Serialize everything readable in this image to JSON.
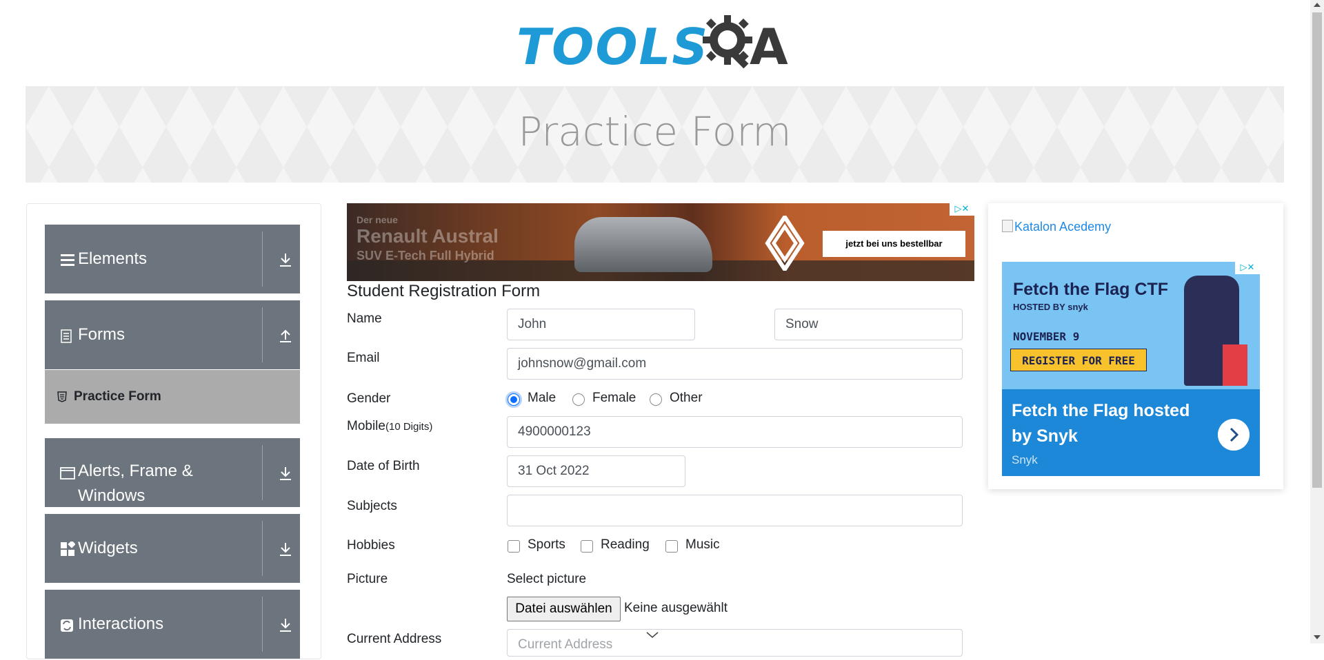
{
  "logo": {
    "part1": "TOOLS",
    "part2": "A"
  },
  "banner": {
    "title": "Practice Form"
  },
  "sidebar": {
    "groups": [
      {
        "label": "Elements",
        "icon": "list-icon",
        "arrow": "download-arrow-icon"
      },
      {
        "label": "Forms",
        "icon": "document-icon",
        "arrow": "upload-arrow-icon"
      },
      {
        "label": "Alerts, Frame & Windows",
        "label_line1": "Alerts, Frame &",
        "label_line2": "Windows",
        "icon": "window-icon",
        "arrow": "download-arrow-icon"
      },
      {
        "label": "Widgets",
        "icon": "widgets-icon",
        "arrow": "download-arrow-icon"
      },
      {
        "label": "Interactions",
        "icon": "interactions-icon",
        "arrow": "download-arrow-icon"
      }
    ],
    "active_item": {
      "label": "Practice Form",
      "icon": "html5-icon"
    }
  },
  "ad_top": {
    "text1": "Der neue",
    "text2": "Renault Austral",
    "text3": "SUV E-Tech Full Hybrid",
    "cta": "jetzt bei uns bestellbar"
  },
  "form": {
    "title": "Student Registration Form",
    "name_label": "Name",
    "first_name": "John",
    "last_name": "Snow",
    "email_label": "Email",
    "email": "johnsnow@gmail.com",
    "gender_label": "Gender",
    "gender_options": [
      "Male",
      "Female",
      "Other"
    ],
    "gender_selected": "Male",
    "mobile_label": "Mobile",
    "mobile_hint": "(10 Digits)",
    "mobile": "4900000123",
    "dob_label": "Date of Birth",
    "dob": "31 Oct 2022",
    "subjects_label": "Subjects",
    "subjects": "",
    "hobbies_label": "Hobbies",
    "hobbies": [
      "Sports",
      "Reading",
      "Music"
    ],
    "picture_label": "Picture",
    "select_picture": "Select picture",
    "file_button": "Datei auswählen",
    "file_status": "Keine ausgewählt",
    "address_label": "Current Address",
    "address_placeholder": "Current Address"
  },
  "right_ad": {
    "katalon_alt": "Katalon Acedemy",
    "headline": "Fetch the Flag CTF",
    "hosted_by": "HOSTED BY snyk",
    "date": "NOVEMBER 9",
    "register": "REGISTER FOR FREE",
    "body": "Fetch the Flag hosted by Snyk",
    "brand": "Snyk"
  },
  "colors": {
    "logo_blue": "#1e9ad6",
    "sidebar_bg": "#6c757d",
    "active_item_bg": "#ababab",
    "radio_selected": "#0d6efd"
  }
}
